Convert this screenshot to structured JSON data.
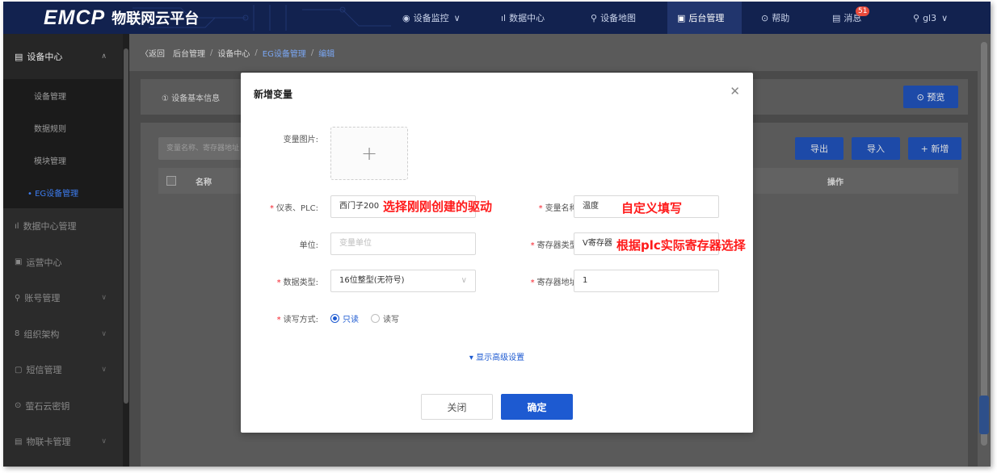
{
  "app": {
    "logo_mark": "EMCP",
    "logo_text": "物联网云平台"
  },
  "topnav": {
    "items": [
      {
        "icon": "◉",
        "label": "设备监控",
        "chevron": "∨"
      },
      {
        "icon": "ıl",
        "label": "数据中心"
      },
      {
        "icon": "⚲",
        "label": "设备地图"
      },
      {
        "icon": "▣",
        "label": "后台管理"
      },
      {
        "icon": "⊙",
        "label": "帮助"
      },
      {
        "icon": "▤",
        "label": "消息"
      }
    ],
    "message_badge": "51",
    "user": {
      "icon": "⚲",
      "label": "gl3",
      "chevron": "∨"
    }
  },
  "sidebar": {
    "head": {
      "icon": "▤",
      "label": "设备中心",
      "chevron": "∧"
    },
    "subitems": [
      {
        "label": "设备管理"
      },
      {
        "label": "数据规则"
      },
      {
        "label": "模块管理"
      },
      {
        "label": "• EG设备管理"
      }
    ],
    "items": [
      {
        "icon": "ıl",
        "label": "数据中心管理"
      },
      {
        "icon": "▣",
        "label": "运营中心"
      },
      {
        "icon": "⚲",
        "label": "账号管理",
        "chevron": "∨"
      },
      {
        "icon": "8",
        "label": "组织架构",
        "chevron": "∨"
      },
      {
        "icon": "▢",
        "label": "短信管理",
        "chevron": "∨"
      },
      {
        "icon": "⊙",
        "label": "萤石云密钥"
      },
      {
        "icon": "▤",
        "label": "物联卡管理",
        "chevron": "∨"
      }
    ]
  },
  "breadcrumb": {
    "back": "〈返回",
    "items": [
      "后台管理",
      "设备中心",
      "EG设备管理",
      "编辑"
    ],
    "separator": "/"
  },
  "main": {
    "tab_basic": "① 设备基本信息",
    "preview_label": "⊙ 预览",
    "search_placeholder": "变量名称、寄存器地址",
    "export_label": "导出",
    "import_label": "导入",
    "add_label": "+ 新增",
    "col_name": "名称",
    "col_op": "操作"
  },
  "modal": {
    "title": "新增变量",
    "close_icon": "✕",
    "image_label": "变量图片:",
    "upload_plus": "+",
    "plc_label": "仪表、PLC:",
    "plc_value": "西门子200",
    "var_name_label": "变量名称:",
    "var_name_value": "温度",
    "unit_label": "单位:",
    "unit_placeholder": "变量单位",
    "reg_type_label": "寄存器类型:",
    "reg_type_value": "V寄存器",
    "data_type_label": "数据类型:",
    "data_type_value": "16位整型(无符号)",
    "data_type_caret": "∨",
    "reg_addr_label": "寄存器地址:",
    "reg_addr_value": "1",
    "rw_label": "读写方式:",
    "rw_options": [
      "只读",
      "读写"
    ],
    "advanced": "▾ 显示高级设置",
    "close_btn": "关闭",
    "ok_btn": "确定"
  },
  "annotations": {
    "plc": "选择刚刚创建的驱动",
    "var_name": "自定义填写",
    "reg_type": "根据plc实际寄存器选择"
  },
  "colors": {
    "brand_blue": "#1d5ad1",
    "topbar": "#12224f",
    "annotation_red": "#ff1a1a"
  }
}
